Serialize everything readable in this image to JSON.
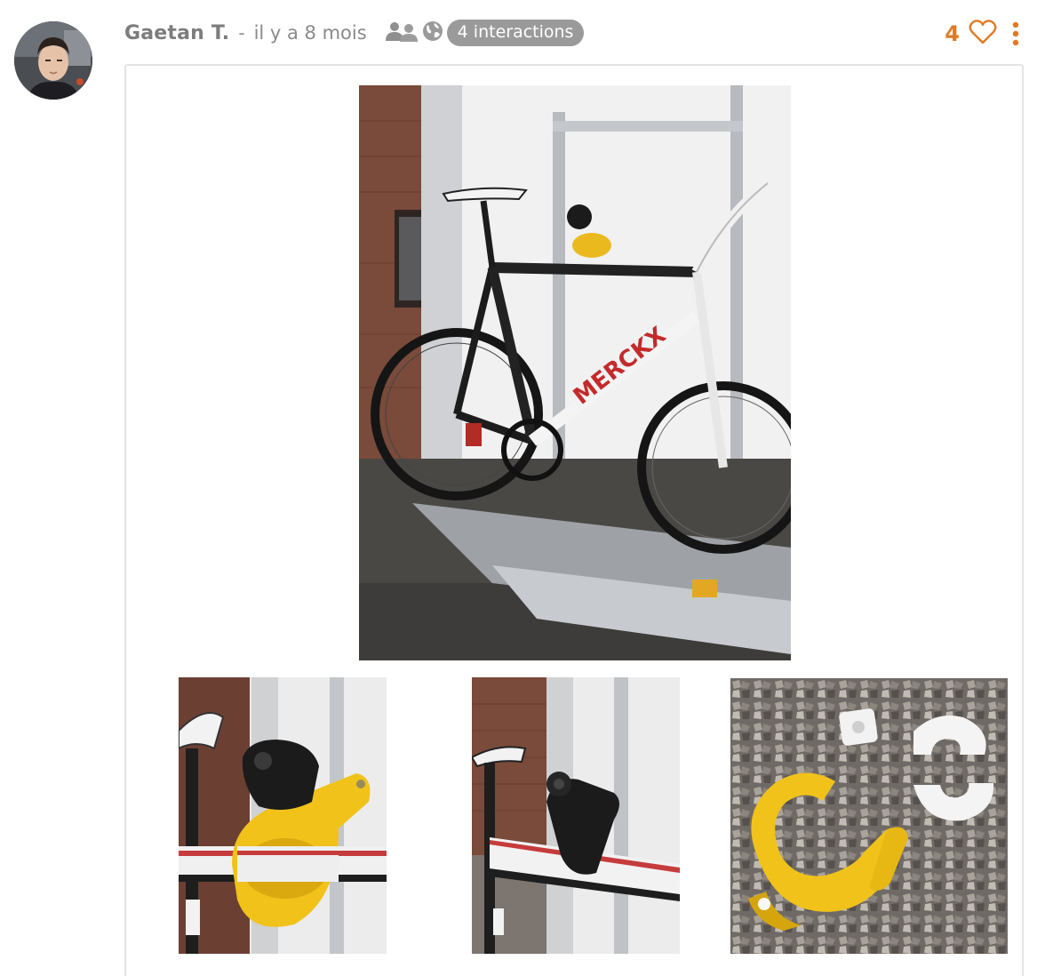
{
  "post": {
    "author": "Gaetan T.",
    "separator": "-",
    "time_ago": "il y a 8 mois",
    "interactions_badge": "4 interactions",
    "like_count": "4"
  },
  "icons": {
    "audience": "group-icon",
    "visibility": "globe-icon",
    "like": "heart-outline-icon",
    "menu": "more-vertical-icon"
  },
  "colors": {
    "accent": "#e07a24",
    "muted_text": "#8a8a8a",
    "badge_bg": "#9a9a9a",
    "card_border": "#e3e3e3"
  },
  "media": [
    {
      "name": "bike-on-rack-photo"
    },
    {
      "name": "lock-closeup-photo"
    },
    {
      "name": "lock-mounted-photo"
    },
    {
      "name": "printed-parts-on-gravel-photo"
    }
  ]
}
